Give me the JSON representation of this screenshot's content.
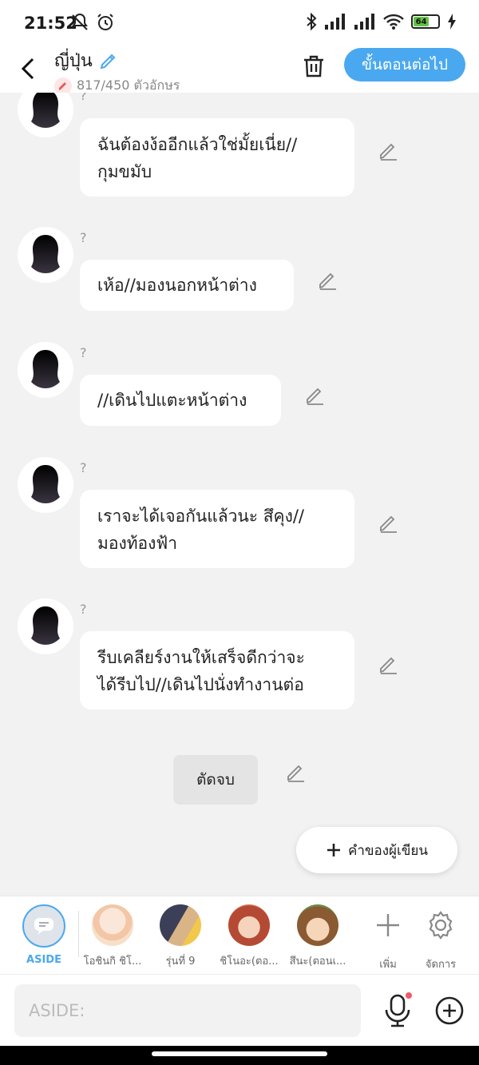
{
  "status": {
    "time": "21:52",
    "battery": "64"
  },
  "header": {
    "title": "ญี่ปุ่น",
    "char_count": "817/450 ตัวอักษร",
    "next_label": "ขั้นตอนต่อไป"
  },
  "messages": [
    {
      "speaker": "?",
      "text": "ฉันต้องง้ออีกแล้วใช่มั้ยเนี่ย//\nกุมขมับ"
    },
    {
      "speaker": "?",
      "text": "เห้อ//มองนอกหน้าต่าง"
    },
    {
      "speaker": "?",
      "text": "//เดินไปแตะหน้าต่าง"
    },
    {
      "speaker": "?",
      "text": "เราจะได้เจอกันแล้วนะ สึคุง//\nมองท้องฟ้า"
    },
    {
      "speaker": "?",
      "text": "รีบเคลียร์งานให้เสร็จดีกว่าจะ\nได้รีบไป//เดินไปนั่งทำงานต่อ"
    }
  ],
  "end_label": "ตัดจบ",
  "author_words_label": "คำของผู้เขียน",
  "characters": [
    {
      "name": "ASIDE"
    },
    {
      "name": "โอชินกิ ชิโ..."
    },
    {
      "name": "รุ่นที่ 9"
    },
    {
      "name": "ชิโนอะ(ตอ..."
    },
    {
      "name": "สึนะ(ตอนเ..."
    }
  ],
  "add_label": "เพิ่ม",
  "manage_label": "จัดการ",
  "input": {
    "placeholder": "ASIDE:"
  },
  "colors": {
    "accent": "#4aa8f0",
    "background": "#f2f2f2"
  }
}
